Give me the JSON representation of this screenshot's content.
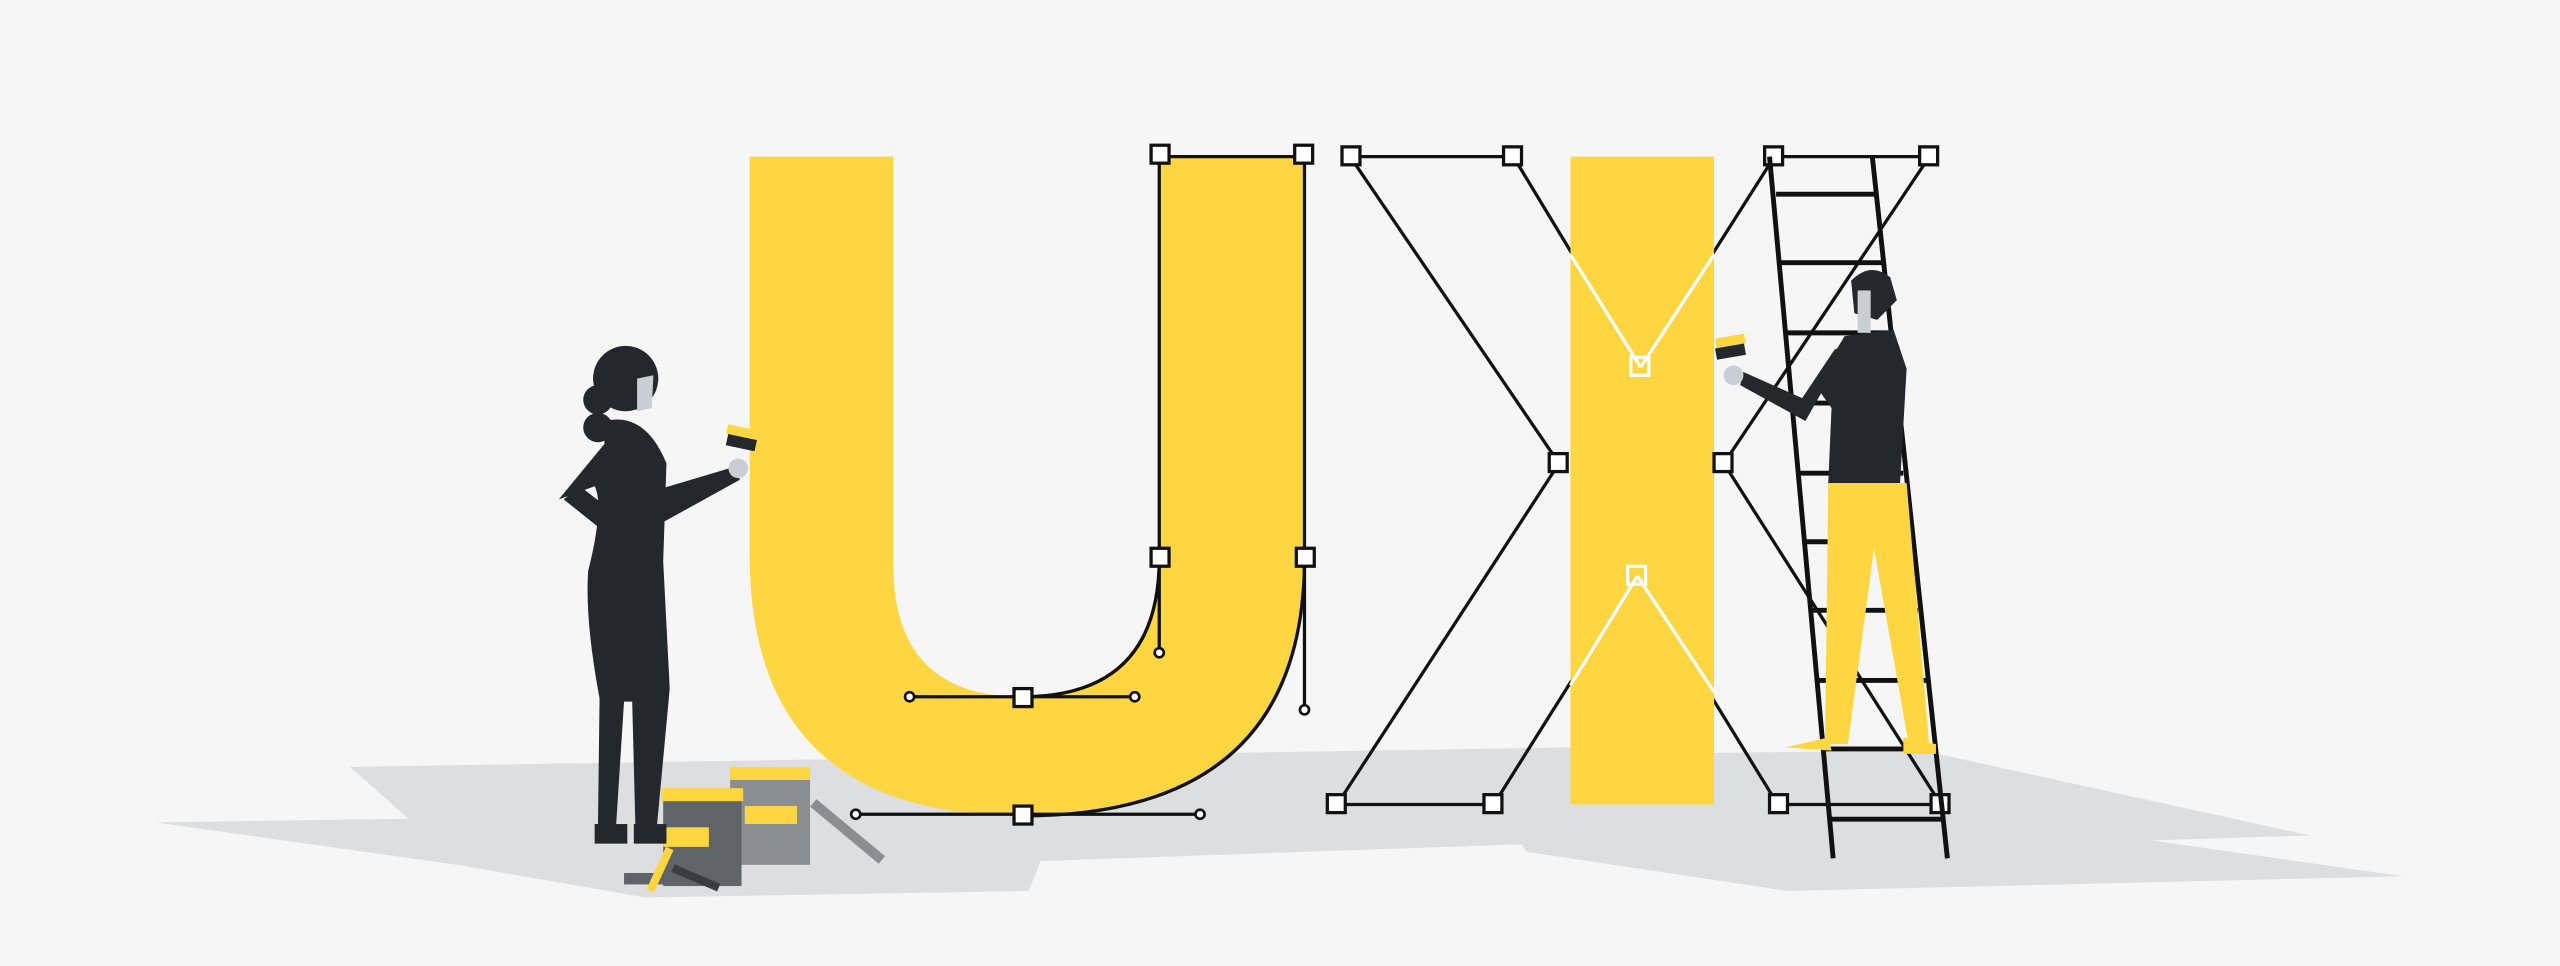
{
  "illustration": {
    "subject": "UX",
    "letters": [
      "U",
      "X"
    ],
    "figures": [
      "painter-woman",
      "painter-man-on-ladder"
    ],
    "colors": {
      "background": "#f6f6f6",
      "shadow": "#dcdee0",
      "accent": "#fdd642",
      "figure": "#24282c",
      "outline": "#111111",
      "can": "#606468",
      "can_light": "#8a8e92",
      "skin_glove": "#c9ced4"
    }
  }
}
